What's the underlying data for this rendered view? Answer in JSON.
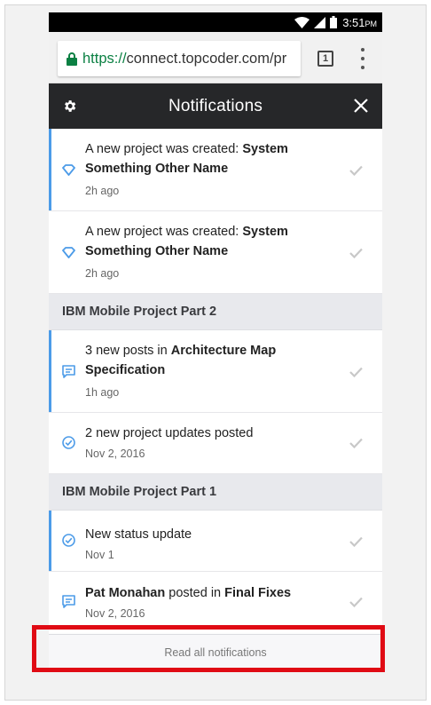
{
  "status_bar": {
    "time": "3:51",
    "ampm": "PM"
  },
  "browser": {
    "url_scheme": "https://",
    "url_rest": "connect.topcoder.com/pr",
    "tab_count": "1"
  },
  "header": {
    "title": "Notifications"
  },
  "items": [
    {
      "prefix": "A new project was created: ",
      "bold": "System Something Other Name",
      "time": "2h ago"
    },
    {
      "prefix": "A new project was created: ",
      "bold": "System Something Other Name",
      "time": "2h ago"
    }
  ],
  "groups": [
    {
      "title": "IBM Mobile Project Part 2",
      "items": [
        {
          "prefix": "3 new posts in ",
          "bold": "Architecture Map Specification",
          "time": "1h ago"
        },
        {
          "prefix": "2 new project updates posted",
          "bold": "",
          "time": "Nov 2, 2016"
        }
      ]
    },
    {
      "title": "IBM Mobile Project Part 1",
      "items": [
        {
          "prefix": "New status update",
          "bold": "",
          "time": "Nov 1"
        },
        {
          "name": "Pat Monahan",
          "mid": " posted in ",
          "bold": "Final Fixes",
          "time": "Nov 2, 2016"
        }
      ]
    }
  ],
  "footer": {
    "read_all_label": "Read all notifications"
  },
  "colors": {
    "accent": "#4c9be8",
    "header_bg": "#262729",
    "highlight": "#e00b14",
    "secure": "#0b8043"
  },
  "icons": [
    "wifi-icon",
    "signal-icon",
    "battery-icon",
    "lock-icon",
    "gear-icon",
    "close-icon",
    "diamond-icon",
    "chat-icon",
    "check-circle-icon",
    "checkmark-icon"
  ]
}
